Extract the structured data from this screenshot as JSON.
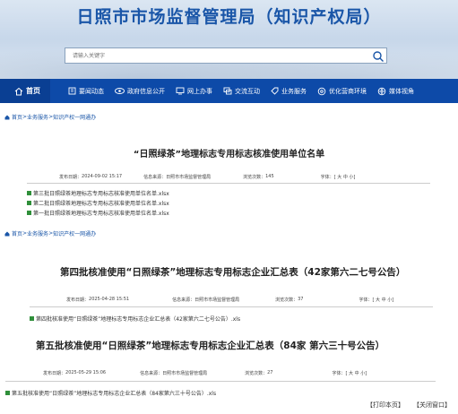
{
  "header": {
    "site_title": "日照市市场监督管理局（知识产权局）",
    "search_placeholder": "请输入关键字"
  },
  "nav": [
    {
      "label": "首页",
      "icon": "home-icon"
    },
    {
      "label": "要闻动态",
      "icon": "building-icon"
    },
    {
      "label": "政府信息公开",
      "icon": "eye-icon"
    },
    {
      "label": "网上办事",
      "icon": "monitor-icon"
    },
    {
      "label": "交流互动",
      "icon": "chat-icon"
    },
    {
      "label": "业务服务",
      "icon": "tag-icon"
    },
    {
      "label": "优化营商环境",
      "icon": "settings-icon"
    },
    {
      "label": "媒体视角",
      "icon": "media-icon"
    }
  ],
  "breadcrumb": {
    "home": "首页",
    "sep": ">",
    "level1": "业务服务",
    "level2": "知识产权一网通办"
  },
  "section1": {
    "title": "“日照绿茶”地理标志专用标志核准使用单位名单",
    "meta": {
      "date_label": "发布日期：",
      "date": "2024-09-02  15:17",
      "source_label": "信息来源：",
      "source": "日照市市场监督管理局",
      "views_label": "浏览次数：",
      "views": "145",
      "font_label": "字体：",
      "font_options": "[ 大 中 小]"
    },
    "attachments": [
      "第三批日照绿茶地理标志专用标志核准使用单位名单.xlsx",
      "第二批日照绿茶地理标志专用标志核准使用单位名单.xlsx",
      "第一批日照绿茶地理标志专用标志核准使用单位名单.xlsx"
    ]
  },
  "section2": {
    "title": "第四批核准使用“日照绿茶”地理标志专用标志企业汇总表（42家第六二七号公告）",
    "meta": {
      "date_label": "发布日期：",
      "date": "2025-04-28  15:51",
      "source_label": "信息来源：",
      "source": "日照市市场监督管理局",
      "views_label": "浏览次数：",
      "views": "37",
      "font_label": "字体：",
      "font_options": "[ 大 中 小]"
    },
    "attachments": [
      "第四批核准使用“日照绿茶”地理标志专用标志企业汇总表（42家第六二七号公告）.xls"
    ]
  },
  "section3": {
    "title": "第五批核准使用“日照绿茶”地理标志专用标志企业汇总表（84家 第六三十号公告）",
    "meta": {
      "date_label": "发布日期：",
      "date": "2025-05-29  15:06",
      "source_label": "信息来源：",
      "source": "日照市市场监督管理局",
      "views_label": "浏览次数：",
      "views": "27",
      "font_label": "字体：",
      "font_options": "[ 大 中 小]"
    },
    "attachments": [
      "第五批核准使用“日照绿茶”地理标志专用标志企业汇总表（84家第六三十号公告）.xls"
    ]
  },
  "footer": {
    "print": "【打印本页】",
    "close": "【关闭窗口】"
  },
  "colors": {
    "nav_bg": "#0d4aa8",
    "title_blue": "#1a56a8",
    "xls_green": "#2f8f3a"
  }
}
